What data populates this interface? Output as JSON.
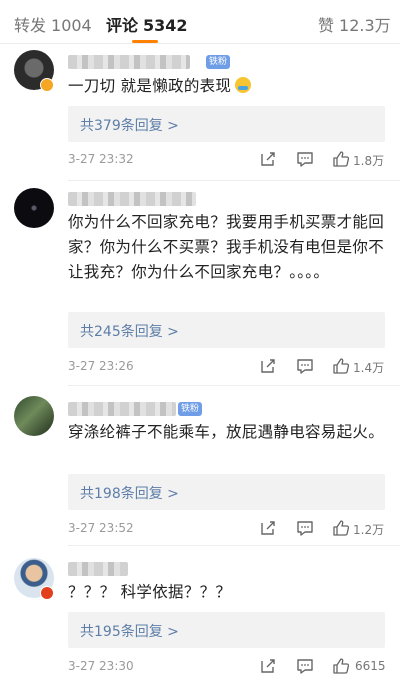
{
  "tabs": {
    "repost": {
      "label": "转发",
      "count": "1004"
    },
    "comments": {
      "label": "评论",
      "count": "5342"
    },
    "likes": {
      "label": "赞",
      "count": "12.3万"
    }
  },
  "colors": {
    "accent": "#ff8200",
    "link": "#5e7ea8",
    "fan_tag": "#6f9ee6"
  },
  "comments": [
    {
      "fan_badge": "铁粉",
      "avatar_badge": "verified-v",
      "text": "一刀切 就是懒政的表现",
      "emoji": "smiling-face-icon",
      "replies": "共379条回复 >",
      "time": "3-27 23:32",
      "likes": "1.8万"
    },
    {
      "fan_badge": "",
      "avatar_badge": "",
      "text": "你为什么不回家充电？我要用手机买票才能回家？你为什么不买票？我手机没有电但是你不让我充？你为什么不回家充电？。。。。",
      "replies": "共245条回复 >",
      "time": "3-27 23:26",
      "likes": "1.4万"
    },
    {
      "fan_badge": "铁粉",
      "avatar_badge": "",
      "text": "穿涤纶裤子不能乘车，放屁遇静电容易起火。",
      "replies": "共198条回复 >",
      "time": "3-27 23:52",
      "likes": "1.2万"
    },
    {
      "fan_badge": "",
      "avatar_badge": "star",
      "text": "？？？ 科学依据？？？",
      "replies": "共195条回复 >",
      "time": "3-27 23:30",
      "likes": "6615"
    }
  ]
}
